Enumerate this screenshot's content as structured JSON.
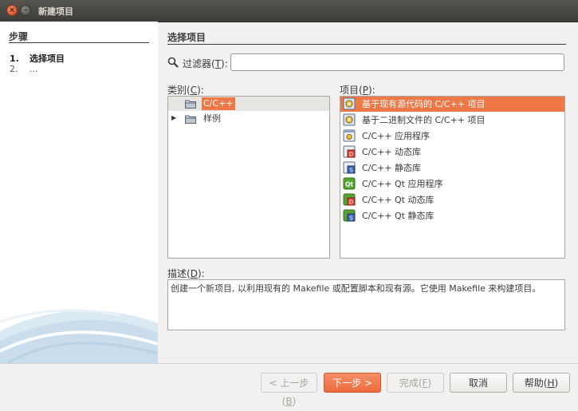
{
  "window": {
    "title": "新建项目"
  },
  "steps": {
    "heading": "步骤",
    "items": [
      {
        "num": "1.",
        "label": "选择项目"
      },
      {
        "num": "2.",
        "label": "..."
      }
    ]
  },
  "main": {
    "heading": "选择项目",
    "filter": {
      "label_pre": "过滤器(",
      "mnemonic": "T",
      "label_post": "):",
      "value": ""
    },
    "categories": {
      "label_pre": "类别(",
      "mnemonic": "C",
      "label_post": "):",
      "items": [
        {
          "label": "C/C++",
          "selected": true,
          "expandable": false
        },
        {
          "label": "样例",
          "selected": false,
          "expandable": true
        }
      ]
    },
    "projects": {
      "label_pre": "项目(",
      "mnemonic": "P",
      "label_post": "):",
      "items": [
        {
          "label": "基于现有源代码的 C/C++ 项目",
          "icon": "cpp-project-gear-icon",
          "selected": true
        },
        {
          "label": "基于二进制文件的 C/C++ 项目",
          "icon": "cpp-project-gear-icon",
          "selected": false
        },
        {
          "label": "C/C++ 应用程序",
          "icon": "cpp-application-icon",
          "selected": false
        },
        {
          "label": "C/C++ 动态库",
          "icon": "cpp-dynamic-library-icon",
          "selected": false
        },
        {
          "label": "C/C++ 静态库",
          "icon": "cpp-static-library-icon",
          "selected": false
        },
        {
          "label": "C/C++ Qt 应用程序",
          "icon": "qt-application-icon",
          "selected": false
        },
        {
          "label": "C/C++ Qt 动态库",
          "icon": "qt-dynamic-library-icon",
          "selected": false
        },
        {
          "label": "C/C++ Qt 静态库",
          "icon": "qt-static-library-icon",
          "selected": false
        }
      ]
    },
    "description": {
      "label_pre": "描述(",
      "mnemonic": "D",
      "label_post": "):",
      "text": "创建一个新项目, 以利用现有的 Makefile 或配置脚本和现有源。它使用 Makefile 来构建项目。"
    }
  },
  "buttons": {
    "back": {
      "label": "< 上一步(",
      "mnemonic": "B",
      "tail": ")",
      "enabled": false
    },
    "next": {
      "label": "下一步 >",
      "enabled": true
    },
    "finish": {
      "label": "完成(",
      "mnemonic": "F",
      "tail": ")",
      "enabled": false
    },
    "cancel": {
      "label": "取消",
      "enabled": true
    },
    "help": {
      "label": "帮助(",
      "mnemonic": "H",
      "tail": ")",
      "enabled": true
    }
  },
  "colors": {
    "accent": "#f07746",
    "titlebar": "#3d3c38",
    "selection_category": "#e6e5e2"
  }
}
